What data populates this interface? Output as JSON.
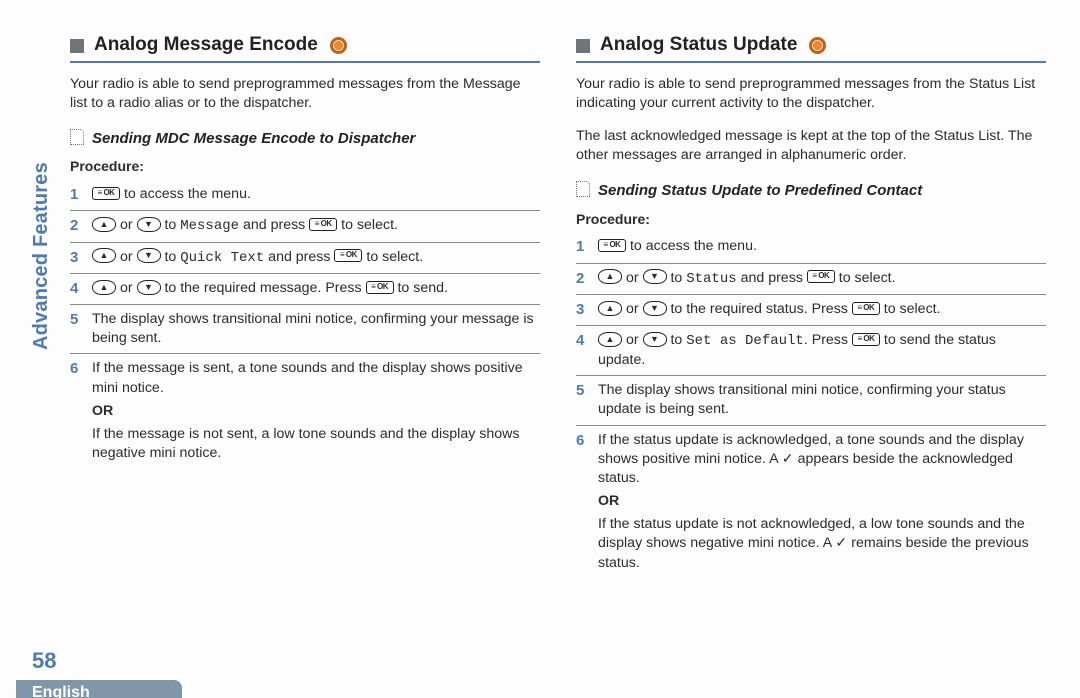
{
  "sideTab": "Advanced Features",
  "pageNumber": "58",
  "language": "English",
  "left": {
    "title": "Analog Message Encode",
    "intro": "Your radio is able to send preprogrammed messages from the Message list to a radio alias or to the dispatcher.",
    "subTitle": "Sending MDC Message Encode to Dispatcher",
    "procLabel": "Procedure:",
    "steps": {
      "s1_tail": " to access the menu.",
      "s2_a": " or ",
      "s2_b": " to ",
      "s2_menu": "Message",
      "s2_c": " and press ",
      "s2_d": " to select.",
      "s3_a": " or ",
      "s3_b": " to ",
      "s3_menu": "Quick Text",
      "s3_c": " and press ",
      "s3_d": " to select.",
      "s4_a": " or ",
      "s4_b": " to the required message. Press ",
      "s4_c": " to send.",
      "s5": " The display shows transitional mini notice, confirming your message is being sent.",
      "s6a": "If the message is sent, a tone sounds and the display shows positive mini notice.",
      "or": "OR",
      "s6b": "If the message is not sent, a low tone sounds and the display shows negative mini notice."
    }
  },
  "right": {
    "title": "Analog Status Update",
    "intro1": "Your radio is able to send preprogrammed messages from the Status List indicating your current activity to the dispatcher.",
    "intro2": "The last acknowledged message is kept at the top of the Status List. The other messages are arranged in alphanumeric order.",
    "subTitle": "Sending Status Update to Predefined Contact",
    "procLabel": "Procedure:",
    "steps": {
      "s1_tail": " to access the menu.",
      "s2_a": " or ",
      "s2_b": " to ",
      "s2_menu": "Status",
      "s2_c": " and press ",
      "s2_d": " to select.",
      "s3_a": " or ",
      "s3_b": " to the required status. Press ",
      "s3_c": " to select.",
      "s4_a": " or ",
      "s4_b": " to ",
      "s4_menu": "Set as Default",
      "s4_c": ". Press ",
      "s4_d": " to send the status update.",
      "s5": "The display shows transitional mini notice, confirming your status update is being sent.",
      "s6a_1": "If the status update is acknowledged, a tone sounds and the display shows positive mini notice. A ",
      "s6a_check": "✓",
      "s6a_2": " appears beside the acknowledged status.",
      "or": "OR",
      "s6b_1": "If the status update is not acknowledged, a low tone sounds and the display shows negative mini notice. A ",
      "s6b_check": "✓",
      "s6b_2": " remains beside the previous status."
    }
  },
  "nums": {
    "n1": "1",
    "n2": "2",
    "n3": "3",
    "n4": "4",
    "n5": "5",
    "n6": "6"
  }
}
